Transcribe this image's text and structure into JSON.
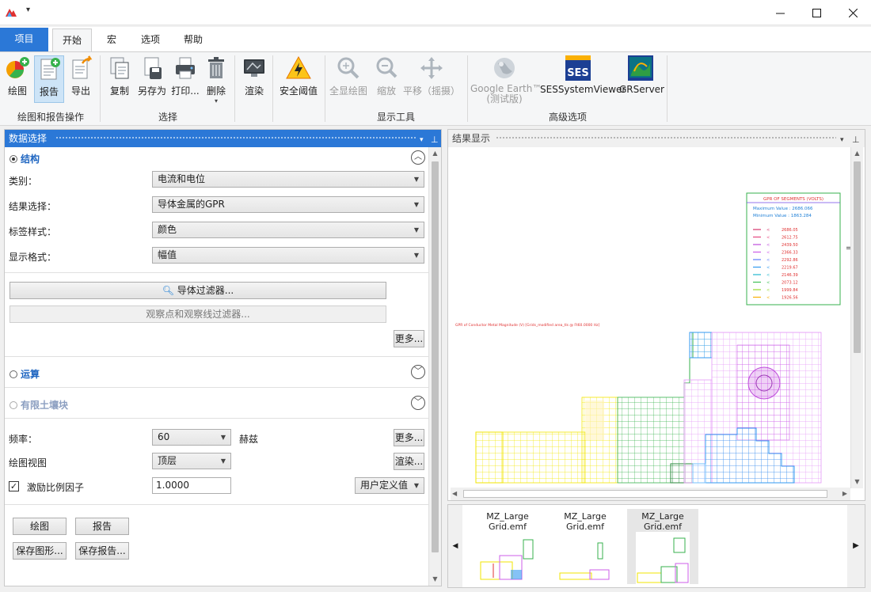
{
  "ribbon_tabs": [
    "项目",
    "开始",
    "宏",
    "选项",
    "帮助"
  ],
  "ribbon": {
    "buttons": {
      "plot": "绘图",
      "report": "报告",
      "export": "导出",
      "copy": "复制",
      "save_as": "另存为",
      "print": "打印...",
      "delete": "删除",
      "render": "渲染",
      "safety_threshold": "安全阈值",
      "show_all": "全显绘图",
      "zoom": "缩放",
      "pan": "平移（摇摄）",
      "google_earth_line1": "Google Earth™",
      "google_earth_line2": "(测试版)",
      "ses_viewer": "SESSystemViewer",
      "grserver": "GRServer"
    },
    "groups": {
      "plot_report": "绘图和报告操作",
      "select": "选择",
      "display_tools": "显示工具",
      "advanced": "高级选项"
    }
  },
  "left_panel": {
    "title": "数据选择",
    "structure_section": "结构",
    "rows": {
      "category_label": "类别：",
      "category_value": "电流和电位",
      "result_label": "结果选择：",
      "result_value": "导体金属的GPR",
      "tag_label": "标签样式：",
      "tag_value": "颜色",
      "format_label": "显示格式：",
      "format_value": "幅值"
    },
    "conductor_filter": "导体过滤器...",
    "observation_filter": "观察点和观察线过滤器...",
    "more1": "更多...",
    "operation_section": "运算",
    "finite_soil_section": "有限土壤块",
    "frequency_label": "频率：",
    "frequency_value": "60",
    "frequency_unit": "赫兹",
    "more2": "更多...",
    "plot_view_label": "绘图视图",
    "plot_view_value": "顶层",
    "render2": "渲染...",
    "excitation_label": "激励比例因子",
    "excitation_checked": true,
    "excitation_value": "1.0000",
    "user_defined": "用户定义值",
    "btn_plot": "绘图",
    "btn_report": "报告",
    "btn_save_plot": "保存图形...",
    "btn_save_report": "保存报告..."
  },
  "right_panel": {
    "title": "结果显示",
    "plot_caption": "GPR of Conductor Metal Magnitude (V) [Grids_modified area_tls  @ Ft60.0000 Hz]",
    "legend": {
      "title": "GPR OF SEGMENTS (VOLTS)",
      "max_label": "Maximum Value : 2686.066",
      "min_label": "Minimum Value : 1863.284",
      "entries": [
        {
          "value": "2686.05",
          "color": "#d6336c"
        },
        {
          "value": "2612.75",
          "color": "#e64980"
        },
        {
          "value": "2439.50",
          "color": "#be4bdb"
        },
        {
          "value": "2366.33",
          "color": "#cc5de8"
        },
        {
          "value": "2292.86",
          "color": "#5c7cfa"
        },
        {
          "value": "2219.67",
          "color": "#339af0"
        },
        {
          "value": "2146.39",
          "color": "#22b8cf"
        },
        {
          "value": "2073.12",
          "color": "#40c057"
        },
        {
          "value": "1999.84",
          "color": "#94d82d"
        },
        {
          "value": "1926.56",
          "color": "#fab005"
        }
      ]
    }
  },
  "thumbnails": [
    "MZ_Large Grid.emf",
    "MZ_Large Grid.emf",
    "MZ_Large Grid.emf"
  ],
  "colors": {
    "accent": "#2b78d7",
    "section_blue": "#1f66c1"
  }
}
